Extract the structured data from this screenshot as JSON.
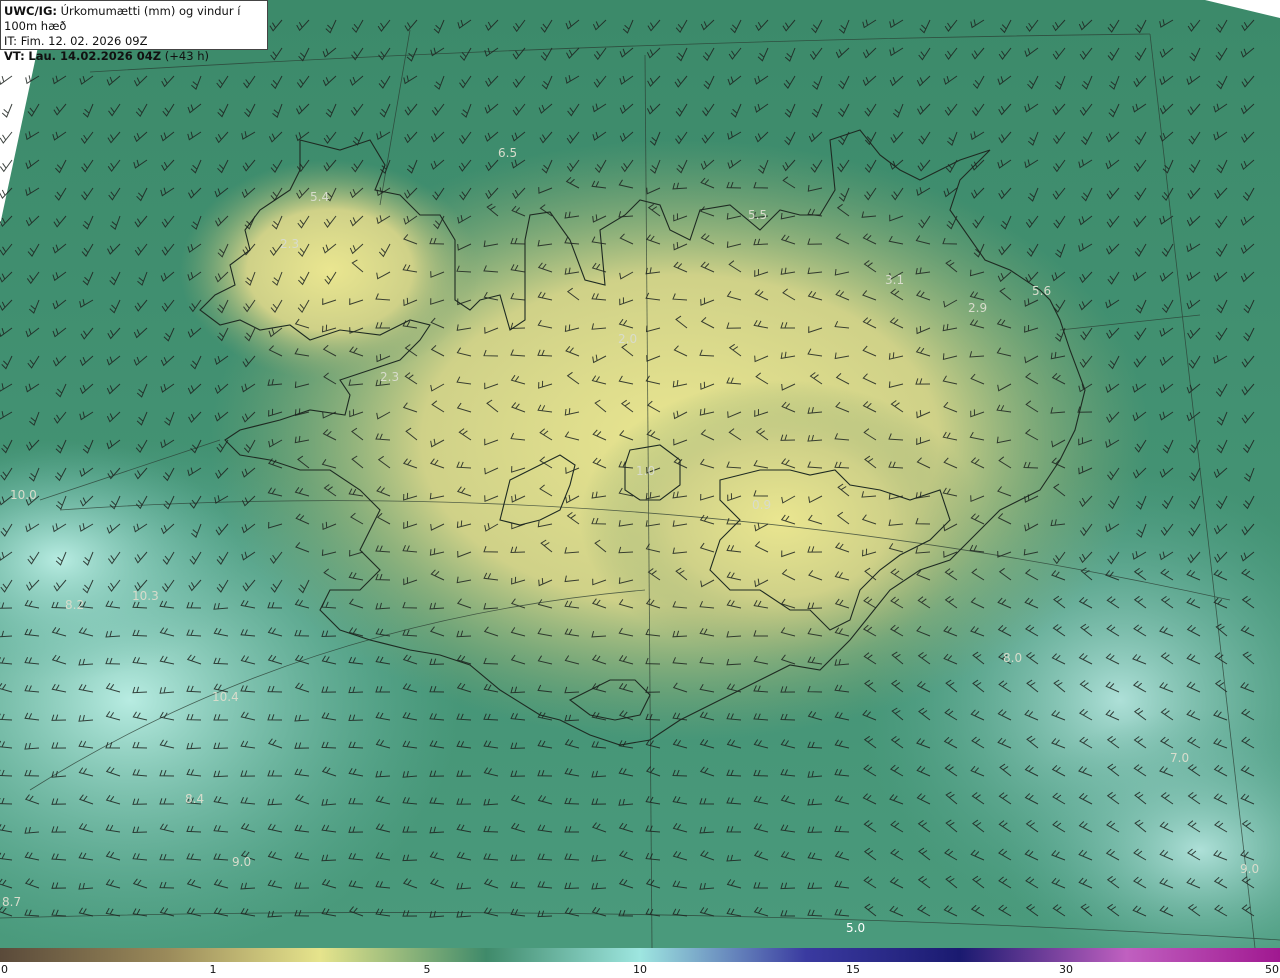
{
  "header": {
    "model": "UWC/IG:",
    "title": "Úrkomumætti (mm) og vindur í 100m hæð",
    "it_label": "IT:",
    "it_value": "Fim. 12. 02. 2026 09Z",
    "vt_label": "VT:",
    "vt_value": "Lau. 14.02.2026 04Z",
    "vt_lead": "(+43 h)"
  },
  "colorbar": {
    "ticks": [
      "0",
      "1",
      "5",
      "10",
      "15",
      "30",
      "50"
    ],
    "colors": [
      "#5a4a3a",
      "#9a8a5a",
      "#e6e48c",
      "#3f8a6a",
      "#9ee6e0",
      "#3a3aa0",
      "#1a1a70",
      "#c060c0",
      "#a01890"
    ]
  },
  "map_values": [
    {
      "label": "6.5"
    },
    {
      "label": "5.4"
    },
    {
      "label": "2.3"
    },
    {
      "label": "5.5"
    },
    {
      "label": "3.1"
    },
    {
      "label": "5.6"
    },
    {
      "label": "2.9"
    },
    {
      "label": "2.0"
    },
    {
      "label": "2.3"
    },
    {
      "label": "1.0"
    },
    {
      "label": "0.9"
    },
    {
      "label": "10.0"
    },
    {
      "label": "8.2"
    },
    {
      "label": "10.3"
    },
    {
      "label": "8.0"
    },
    {
      "label": "10.4"
    },
    {
      "label": "7.0"
    },
    {
      "label": "8.4"
    },
    {
      "label": "9.0"
    },
    {
      "label": "9.0"
    },
    {
      "label": "5.0"
    },
    {
      "label": "8.7"
    }
  ],
  "colors": {
    "land_low": "#e8e490",
    "land_mid": "#a8b870",
    "sea_mid": "#3f8a6a",
    "sea_light": "#a4dcd4",
    "outline": "#1e2a22"
  }
}
